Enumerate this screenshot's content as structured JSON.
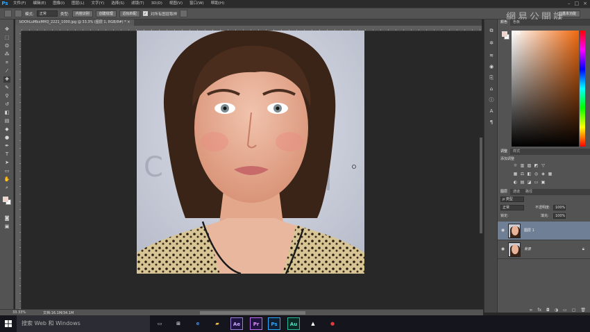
{
  "app": {
    "logo": "Ps"
  },
  "menu": [
    "文件(F)",
    "编辑(E)",
    "图像(I)",
    "图层(L)",
    "文字(Y)",
    "选择(S)",
    "滤镜(T)",
    "3D(D)",
    "视图(V)",
    "窗口(W)",
    "帮助(H)"
  ],
  "window_buttons": [
    "–",
    "□",
    "×"
  ],
  "options_bar": {
    "mode_label": "模式:",
    "mode_value": "正常",
    "type_label": "类型:",
    "btn_proximity": "近似匹配",
    "btn_texture": "创建纹理",
    "btn_content_aware": "内容识别",
    "sample_all_label": "对所有图层取样",
    "workspace": "基本功能"
  },
  "watermark": "網易公開課",
  "document": {
    "tab_title": "bDOhLuMbxMHQ_2221_1000.jpg @ 33.3% (图层 1, RGB/8#) *  ×",
    "zoom": "33.33%",
    "doc_info": "文档:16.1M/34.1M"
  },
  "panels": {
    "color_tabs": [
      "颜色",
      "色板"
    ],
    "adjustments_tabs": [
      "调整",
      "样式"
    ],
    "adjustments_title": "添加调整",
    "layers_tabs": [
      "图层",
      "通道",
      "路径"
    ],
    "kind_label": "ρ 类型",
    "blend_mode": "正常",
    "opacity_label": "不透明度:",
    "opacity_value": "100%",
    "lock_label": "锁定:",
    "fill_label": "填充:",
    "fill_value": "100%",
    "layers": [
      {
        "name": "图层 1",
        "selected": true
      },
      {
        "name": "背景",
        "selected": false
      }
    ]
  },
  "taskbar": {
    "search_placeholder": "搜索 Web 和 Windows",
    "apps": [
      "Ae",
      "Pr",
      "Ps",
      "Au"
    ]
  },
  "colors": {
    "foreground": "#f1d3ca",
    "background": "#ffffff",
    "selected_layer": "#6f7f96",
    "ps_blue": "#31a8ff"
  }
}
